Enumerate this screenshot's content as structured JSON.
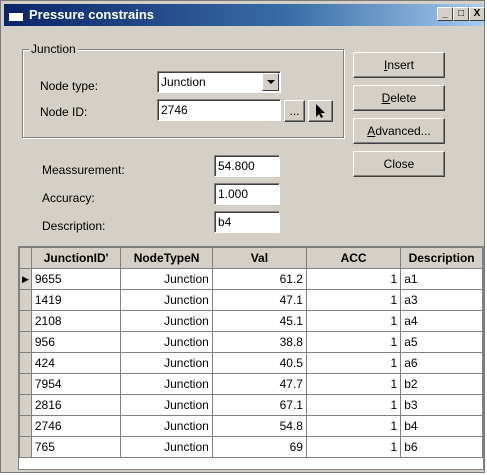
{
  "window": {
    "title": "Pressure constrains",
    "minimize": "_",
    "maximize": "□",
    "close": "X"
  },
  "junction_group": {
    "legend": "Junction",
    "node_type_label": "Node type:",
    "node_type_value": "Junction",
    "node_id_label": "Node ID:",
    "node_id_value": "2746",
    "browse_label": "..."
  },
  "buttons": {
    "insert_access": "I",
    "insert_rest": "nsert",
    "delete_access": "D",
    "delete_rest": "elete",
    "advanced_access": "A",
    "advanced_rest": "dvanced...",
    "close": "Close"
  },
  "form": {
    "measurement_label": "Meassurement:",
    "measurement_value": "54.800",
    "accuracy_label": "Accuracy:",
    "accuracy_value": "1.000",
    "description_label": "Description:",
    "description_value": "b4"
  },
  "grid": {
    "columns": [
      "JunctionID'",
      "NodeTypeN",
      "Val",
      "ACC",
      "Description"
    ],
    "rows": [
      [
        "9655",
        "Junction",
        "61.2",
        "1",
        "a1"
      ],
      [
        "1419",
        "Junction",
        "47.1",
        "1",
        "a3"
      ],
      [
        "2108",
        "Junction",
        "45.1",
        "1",
        "a4"
      ],
      [
        "956",
        "Junction",
        "38.8",
        "1",
        "a5"
      ],
      [
        "424",
        "Junction",
        "40.5",
        "1",
        "a6"
      ],
      [
        "7954",
        "Junction",
        "47.7",
        "1",
        "b2"
      ],
      [
        "2816",
        "Junction",
        "67.1",
        "1",
        "b3"
      ],
      [
        "2746",
        "Junction",
        "54.8",
        "1",
        "b4"
      ],
      [
        "765",
        "Junction",
        "69",
        "1",
        "b6"
      ]
    ],
    "current_row_marker": "▶"
  }
}
